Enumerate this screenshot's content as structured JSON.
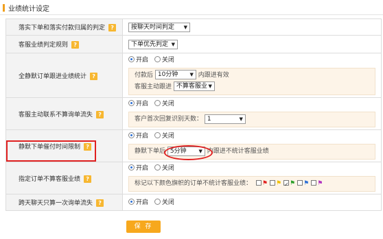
{
  "page": {
    "title": "业绩统计设定"
  },
  "rows": [
    {
      "label": "落实下单和落实付款归属的判定",
      "select": "按聊天时间判定"
    },
    {
      "label": "客服业绩判定规则",
      "select": "下单优先判定"
    },
    {
      "label": "全静默订单跟进业绩统计",
      "radio_on": "开启",
      "radio_off": "关闭",
      "line1_prefix": "付款后",
      "line1_select": "10分钟",
      "line1_suffix": "内跟进有效",
      "line2_prefix": "客服主动跟进",
      "line2_select": "不算客服业"
    },
    {
      "label": "客服主动联系不算询单流失",
      "radio_on": "开启",
      "radio_off": "关闭",
      "line1_prefix": "客户首次回复识别天数：",
      "line1_select": "1"
    },
    {
      "label": "静默下单催付时间限制",
      "radio_on": "开启",
      "radio_off": "关闭",
      "line1_prefix": "静默下单后",
      "line1_select": "5分钟",
      "line1_suffix": "内跟进不统计客服业绩"
    },
    {
      "label": "指定订单不算客服业绩",
      "radio_on": "开启",
      "radio_off": "关闭",
      "flags_text": "标记以下颜色旗帜的订单不统计客服业绩：",
      "flags": [
        {
          "color": "#e02020",
          "checked": false
        },
        {
          "color": "#f0c000",
          "checked": false
        },
        {
          "color": "#2aa02a",
          "checked": true
        },
        {
          "color": "#2a6fd6",
          "checked": false
        },
        {
          "color": "#b030c0",
          "checked": false
        }
      ]
    },
    {
      "label": "跨天聊天只算一次询单流失",
      "radio_on": "开启",
      "radio_off": "关闭"
    }
  ],
  "help_glyph": "?",
  "save_label": "保 存",
  "colors": {
    "accent": "#f7a81d",
    "highlight": "#e02020",
    "subbox_bg": "#fdf4e8"
  }
}
